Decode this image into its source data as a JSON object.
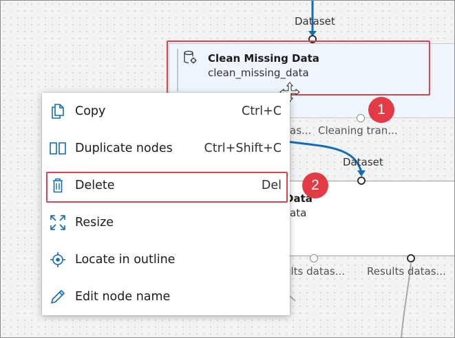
{
  "canvas": {
    "top_port_label": "Dataset",
    "second_port_label": "Dataset",
    "node1": {
      "title": "Clean Missing Data",
      "subtitle": "clean_missing_data"
    },
    "node1_outputs": [
      "as...",
      "Cleaning tran..."
    ],
    "node2": {
      "title": "Data",
      "subtitle": "ata"
    },
    "node2_outputs": [
      "ults datas...",
      "Results datas..."
    ]
  },
  "context_menu": {
    "items": [
      {
        "label": "Copy",
        "shortcut": "Ctrl+C",
        "icon": "copy-icon"
      },
      {
        "label": "Duplicate nodes",
        "shortcut": "Ctrl+Shift+C",
        "icon": "duplicate-icon"
      },
      {
        "label": "Delete",
        "shortcut": "Del",
        "icon": "trash-icon"
      },
      {
        "label": "Resize",
        "shortcut": "",
        "icon": "resize-icon"
      },
      {
        "label": "Locate in outline",
        "shortcut": "",
        "icon": "locate-icon"
      },
      {
        "label": "Edit node name",
        "shortcut": "",
        "icon": "pencil-icon"
      }
    ]
  },
  "callouts": [
    "1",
    "2"
  ],
  "colors": {
    "accent": "#0f6cbd",
    "callout": "#e23b44",
    "node_selected_bg": "#eef5fc"
  }
}
